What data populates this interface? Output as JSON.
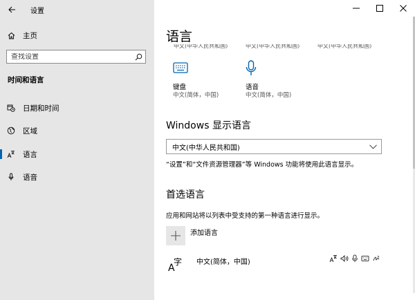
{
  "window": {
    "title": "设置"
  },
  "sidebar": {
    "home_label": "主页",
    "search_placeholder": "查找设置",
    "section_title": "时间和语言",
    "items": [
      {
        "label": "日期和时间",
        "icon": "calendar-clock-icon"
      },
      {
        "label": "区域",
        "icon": "globe-icon"
      },
      {
        "label": "语言",
        "icon": "language-icon",
        "active": true
      },
      {
        "label": "语音",
        "icon": "microphone-icon"
      }
    ]
  },
  "main": {
    "title": "语言",
    "cut_row": [
      "中文(中华人民共和国)",
      "中文(中华人民共和国)",
      "中文(中华人民共和国)"
    ],
    "features": [
      {
        "label": "键盘",
        "sub": "中文(简体，中国)",
        "icon": "keyboard-icon"
      },
      {
        "label": "语音",
        "sub": "中文(简体，中国)",
        "icon": "microphone-icon"
      }
    ],
    "display_language": {
      "heading": "Windows 显示语言",
      "selected": "中文(中华人民共和国)",
      "note": "“设置”和“文件资源管理器”等 Windows 功能将使用此语言显示。"
    },
    "preferred": {
      "heading": "首选语言",
      "description": "应用和网站将以列表中受支持的第一种语言进行显示。",
      "add_label": "添加语言",
      "languages": [
        {
          "name": "中文(简体，中国)",
          "glyph_top": "字",
          "glyph_bottom": "A"
        }
      ]
    }
  },
  "colors": {
    "accent": "#0063b1",
    "sidebar_bg": "#e6e6e6"
  }
}
